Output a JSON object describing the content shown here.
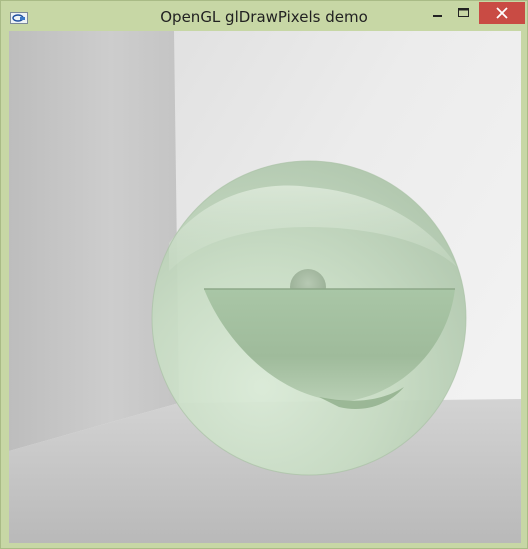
{
  "window": {
    "title": "OpenGL glDrawPixels demo",
    "icon": "opengl-app-icon"
  },
  "controls": {
    "minimize": "minimize-icon",
    "maximize": "maximize-icon",
    "close": "close-icon",
    "close_color": "#c94b44"
  },
  "colors": {
    "titlebar": "#c7d7a5",
    "sphere_tint": "#cfe3cc"
  }
}
